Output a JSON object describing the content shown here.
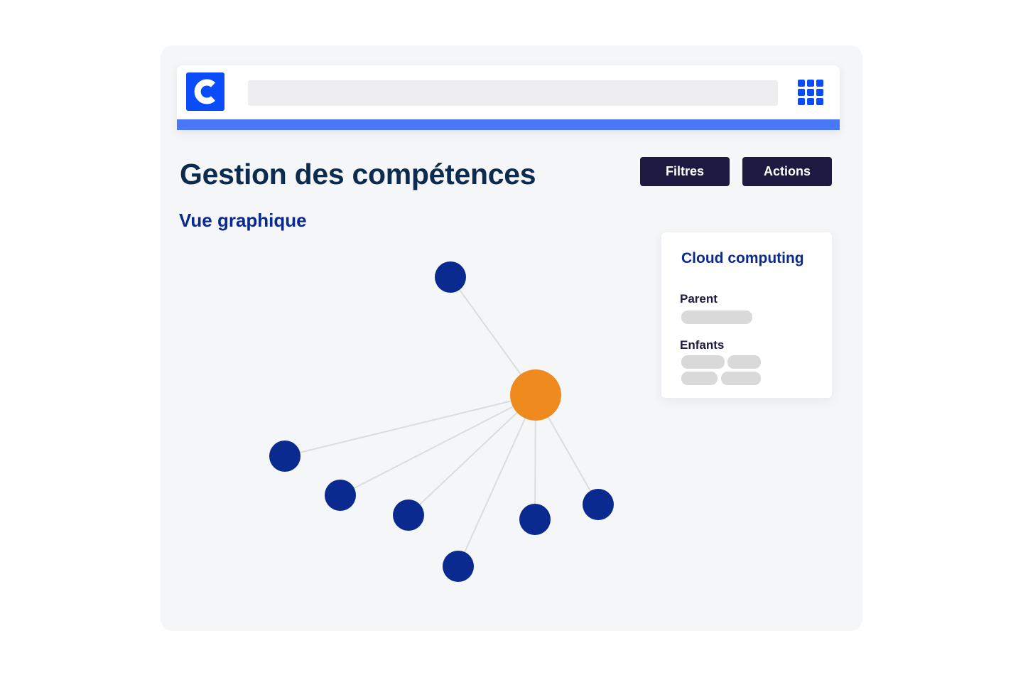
{
  "header": {
    "logo_letter": "C",
    "search": {
      "value": "",
      "placeholder": ""
    },
    "apps_icon": "grid-icon"
  },
  "page": {
    "title": "Gestion des compétences",
    "section_title": "Vue graphique"
  },
  "toolbar": {
    "filters_label": "Filtres",
    "actions_label": "Actions"
  },
  "detail_card": {
    "title": "Cloud computing",
    "parent_label": "Parent",
    "children_label": "Enfants"
  },
  "graph": {
    "central_node": {
      "name": "Cloud computing",
      "color": "#ef8a1f"
    },
    "child_node_color": "#0b2a8f",
    "edge_color": "#dcdcdc",
    "nodes": [
      {
        "id": "center",
        "role": "selected"
      },
      {
        "id": "n1",
        "role": "parent"
      },
      {
        "id": "n2",
        "role": "child"
      },
      {
        "id": "n3",
        "role": "child"
      },
      {
        "id": "n4",
        "role": "child"
      },
      {
        "id": "n5",
        "role": "child"
      },
      {
        "id": "n6",
        "role": "child"
      },
      {
        "id": "n7",
        "role": "child"
      }
    ],
    "edges": [
      [
        "center",
        "n1"
      ],
      [
        "center",
        "n2"
      ],
      [
        "center",
        "n3"
      ],
      [
        "center",
        "n4"
      ],
      [
        "center",
        "n5"
      ],
      [
        "center",
        "n6"
      ],
      [
        "center",
        "n7"
      ]
    ]
  },
  "colors": {
    "brand_blue": "#0a4bfa",
    "accent_bar": "#4877f8",
    "title_navy": "#0d2b4e",
    "heading_blue": "#0a2a8f",
    "button_dark": "#1c1a40",
    "placeholder_gray": "#d9d9d9"
  }
}
